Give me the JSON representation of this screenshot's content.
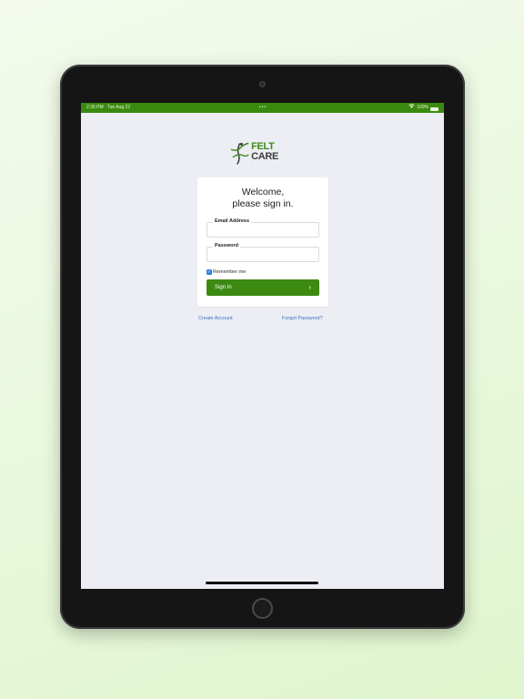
{
  "status_bar": {
    "time": "2:35 PM",
    "date": "Tue Aug 22",
    "center_dots": "•••",
    "battery_text": "100%"
  },
  "logo": {
    "felt": "FELT",
    "care": " CARE",
    "tagline": "—"
  },
  "login": {
    "title_line1": "Welcome,",
    "title_line2": "please sign in.",
    "email_label": "Email Address",
    "email_value": "",
    "password_label": "Password",
    "password_value": "",
    "remember_label": "Remember me",
    "remember_checked": true,
    "signin_label": "Sign In"
  },
  "links": {
    "create_account": "Create Account",
    "forgot_password": "Forgot Password?"
  },
  "colors": {
    "brand_green": "#3d8a12",
    "status_green": "#3a8a0f",
    "link_blue": "#3b6fbf",
    "checkbox_blue": "#2b7fd9"
  }
}
